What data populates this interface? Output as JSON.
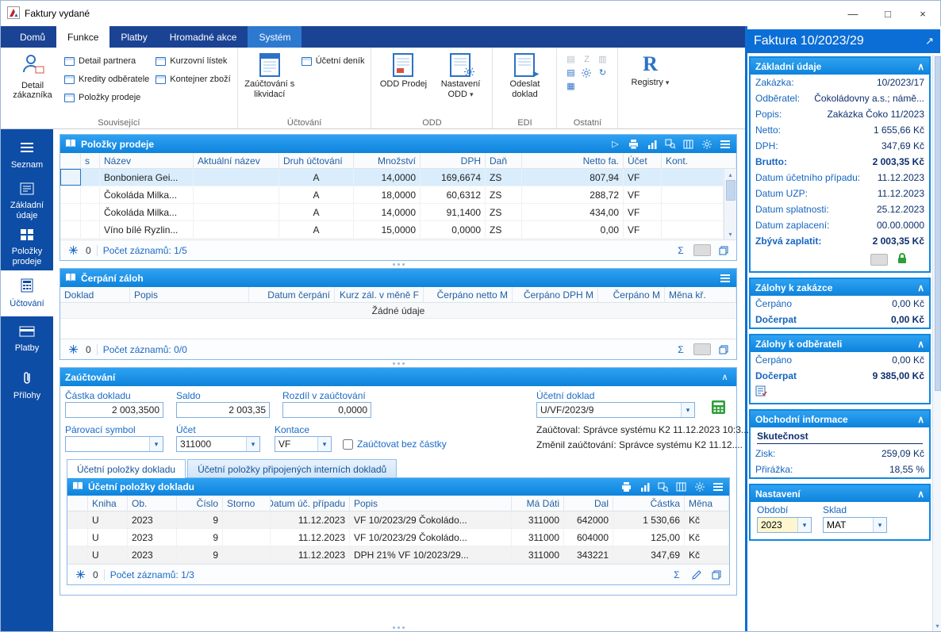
{
  "icons": {
    "play": "▷",
    "dropdown": "▾",
    "collapse": "∧",
    "sum": "Σ",
    "external": "↗",
    "refresh": "↻",
    "minimize": "—",
    "maximize": "□",
    "close": "×",
    "scroll_up": "▴",
    "scroll_down": "▾",
    "tool_a": "▤",
    "tool_z": "Z",
    "tool_b": "▥",
    "tool_c": "▦",
    "registry_r": "R",
    "send_arrow": "▶"
  },
  "window": {
    "title": "Faktury vydané"
  },
  "menu_tabs": [
    "Domů",
    "Funkce",
    "Platby",
    "Hromadné akce",
    "Systém"
  ],
  "ribbon": {
    "souvisejici": {
      "label": "Související",
      "big": "Detail zákazníka",
      "items1": [
        "Detail partnera",
        "Kredity odběratele",
        "Položky prodeje"
      ],
      "items2": [
        "Kurzovní lístek",
        "Kontejner zboží"
      ]
    },
    "uctovani": {
      "label": "Účtování",
      "big": "Zaúčtování s likvidací",
      "item": "Účetní deník"
    },
    "odd": {
      "label": "ODD",
      "big1": "ODD Prodej",
      "big2": "Nastavení ODD"
    },
    "edi": {
      "label": "EDI",
      "big": "Odeslat doklad"
    },
    "ostatni": {
      "label": "Ostatní"
    },
    "registry": {
      "label": "Registry"
    }
  },
  "sidebar": {
    "items": [
      "Seznam",
      "Základní údaje",
      "Položky prodeje",
      "Účtování",
      "Platby",
      "Přílohy"
    ]
  },
  "sales": {
    "title": "Položky prodeje",
    "columns": [
      "s",
      "Název",
      "Aktuální název",
      "Druh účtování",
      "Množství",
      "DPH",
      "Daň",
      "Netto fa.",
      "Účet",
      "Kont."
    ],
    "rows": [
      {
        "nazev": "Bonboniera Gei...",
        "druh": "A",
        "mnozstvi": "14,0000",
        "dph": "169,6674",
        "dan": "ZS",
        "netto": "807,94",
        "ucet": "VF"
      },
      {
        "nazev": "Čokoláda Milka...",
        "druh": "A",
        "mnozstvi": "18,0000",
        "dph": "60,6312",
        "dan": "ZS",
        "netto": "288,72",
        "ucet": "VF"
      },
      {
        "nazev": "Čokoláda Milka...",
        "druh": "A",
        "mnozstvi": "14,0000",
        "dph": "91,1400",
        "dan": "ZS",
        "netto": "434,00",
        "ucet": "VF"
      },
      {
        "nazev": "Víno bílé Ryzlin...",
        "druh": "A",
        "mnozstvi": "15,0000",
        "dph": "0,0000",
        "dan": "ZS",
        "netto": "0,00",
        "ucet": "VF"
      }
    ],
    "filter_count": "0",
    "record_count": "Počet záznamů: 1/5"
  },
  "advances": {
    "title": "Čerpání záloh",
    "columns": [
      "Doklad",
      "Popis",
      "Datum čerpání",
      "Kurz zál. v měně F",
      "Čerpáno netto M",
      "Čerpáno DPH M",
      "Čerpáno M",
      "Měna kř."
    ],
    "empty": "Žádné údaje",
    "filter_count": "0",
    "record_count": "Počet záznamů: 0/0"
  },
  "posting": {
    "title": "Zaúčtování",
    "fields": {
      "castka_dokladu_label": "Částka dokladu",
      "castka_dokladu": "2 003,3500",
      "saldo_label": "Saldo",
      "saldo": "2 003,35",
      "rozdil_label": "Rozdíl v zaúčtování",
      "rozdil": "0,0000",
      "ucetni_doklad_label": "Účetní doklad",
      "ucetni_doklad": "U/VF/2023/9",
      "parovaci_symbol_label": "Párovací symbol",
      "parovaci_symbol": "",
      "ucet_label": "Účet",
      "ucet": "311000",
      "kontace_label": "Kontace",
      "kontace": "VF",
      "bez_castky_label": "Zaúčtovat bez částky"
    },
    "zauctoval": "Zaúčtoval: Správce systému K2 11.12.2023 10:3...",
    "zmenil": "Změnil zaúčtování: Správce systému K2 11.12....",
    "tabs": [
      "Účetní položky dokladu",
      "Účetní položky připojených interních dokladů"
    ],
    "table": {
      "title": "Účetní položky dokladu",
      "columns": [
        "Kniha",
        "Ob.",
        "Číslo",
        "Storno",
        "Datum úč. případu",
        "Popis",
        "Má Dáti",
        "Dal",
        "Částka",
        "Měna"
      ],
      "rows": [
        {
          "kniha": "U",
          "ob": "2023",
          "cislo": "9",
          "storno": "",
          "datum": "11.12.2023",
          "popis": "VF 10/2023/29 Čokoládo...",
          "ma_dati": "311000",
          "dal": "642000",
          "castka": "1 530,66",
          "mena": "Kč"
        },
        {
          "kniha": "U",
          "ob": "2023",
          "cislo": "9",
          "storno": "",
          "datum": "11.12.2023",
          "popis": "VF 10/2023/29 Čokoládo...",
          "ma_dati": "311000",
          "dal": "604000",
          "castka": "125,00",
          "mena": "Kč"
        },
        {
          "kniha": "U",
          "ob": "2023",
          "cislo": "9",
          "storno": "",
          "datum": "11.12.2023",
          "popis": "DPH 21% VF 10/2023/29...",
          "ma_dati": "311000",
          "dal": "343221",
          "castka": "347,69",
          "mena": "Kč"
        }
      ],
      "filter_count": "0",
      "record_count": "Počet záznamů: 1/3"
    }
  },
  "info": {
    "title": "Faktura 10/2023/29",
    "basic": {
      "header": "Základní údaje",
      "rows": [
        {
          "label": "Zakázka:",
          "value": "10/2023/17"
        },
        {
          "label": "Odběratel:",
          "value": "Čokoládovny a.s.; námě..."
        },
        {
          "label": "Popis:",
          "value": "Zakázka Čoko 11/2023"
        },
        {
          "label": "Netto:",
          "value": "1 655,66 Kč"
        },
        {
          "label": "DPH:",
          "value": "347,69 Kč"
        },
        {
          "label": "Brutto:",
          "value": "2 003,35 Kč"
        },
        {
          "label": "Datum účetního případu:",
          "value": "11.12.2023"
        },
        {
          "label": "Datum UZP:",
          "value": "11.12.2023"
        },
        {
          "label": "Datum splatnosti:",
          "value": "25.12.2023"
        },
        {
          "label": "Datum zaplacení:",
          "value": "00.00.0000"
        },
        {
          "label": "Zbývá zaplatit:",
          "value": "2 003,35 Kč"
        }
      ]
    },
    "zalohy_zakazka": {
      "header": "Zálohy k zakázce",
      "rows": [
        {
          "label": "Čerpáno",
          "value": "0,00 Kč"
        },
        {
          "label": "Dočerpat",
          "value": "0,00 Kč"
        }
      ]
    },
    "zalohy_odberatel": {
      "header": "Zálohy k odběrateli",
      "rows": [
        {
          "label": "Čerpáno",
          "value": "0,00 Kč"
        },
        {
          "label": "Dočerpat",
          "value": "9 385,00 Kč"
        }
      ]
    },
    "obchodni": {
      "header": "Obchodní informace",
      "subheader": "Skutečnost",
      "rows": [
        {
          "label": "Zisk:",
          "value": "259,09 Kč"
        },
        {
          "label": "Přirážka:",
          "value": "18,55 %"
        }
      ]
    },
    "nastaveni": {
      "header": "Nastavení",
      "obdobi_label": "Období",
      "obdobi": "2023",
      "sklad_label": "Sklad",
      "sklad": "MAT"
    }
  }
}
